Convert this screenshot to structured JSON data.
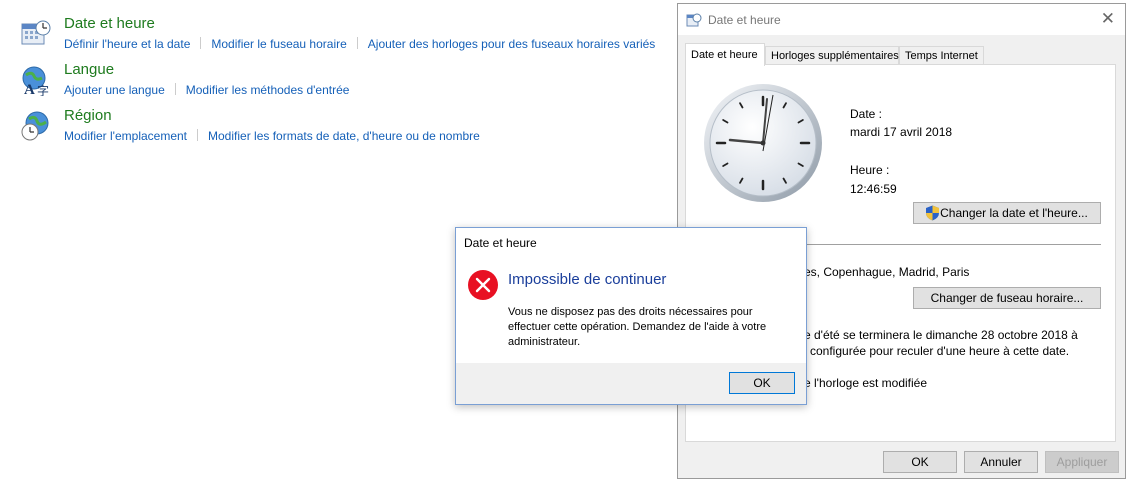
{
  "control_panel": {
    "categories": [
      {
        "title": "Date et heure",
        "icon": "calendar-clock-icon",
        "links": [
          "Définir l'heure et la date",
          "Modifier le fuseau horaire",
          "Ajouter des horloges pour des fuseaux horaires variés"
        ]
      },
      {
        "title": "Langue",
        "icon": "language-globe-icon",
        "links": [
          "Ajouter une langue",
          "Modifier les méthodes d'entrée"
        ]
      },
      {
        "title": "Région",
        "icon": "region-globe-clock-icon",
        "links": [
          "Modifier l'emplacement",
          "Modifier les formats de date, d'heure ou de nombre"
        ]
      }
    ],
    "title_color": "#1e7b1e",
    "link_color": "#1560b8"
  },
  "datetime_dialog": {
    "title": "Date et heure",
    "tabs": [
      "Date et heure",
      "Horloges supplémentaires",
      "Temps Internet"
    ],
    "date_label": "Date :",
    "date_value": "mardi 17 avril 2018",
    "time_label": "Heure :",
    "time_value": "12:46:59",
    "change_datetime_button": "Changer la date et l'heure...",
    "timezone_partial": "es, Copenhague, Madrid, Paris",
    "change_timezone_button": "Changer de fuseau horaire...",
    "dst_line1": "e d'été se terminera le dimanche 28 octobre 2018 à",
    "dst_line2": "configurée pour reculer d'une heure à cette date.",
    "notify_partial": "e l'horloge est modifiée",
    "ok_button": "OK",
    "cancel_button": "Annuler",
    "apply_button": "Appliquer"
  },
  "error_dialog": {
    "title": "Date et heure",
    "heading": "Impossible de continuer",
    "message": "Vous ne disposez pas des droits nécessaires pour effectuer cette opération. Demandez de l'aide à votre administrateur.",
    "ok_button": "OK",
    "icon": "error-x-icon",
    "heading_color": "#1a3e9b",
    "icon_color": "#e81123"
  }
}
